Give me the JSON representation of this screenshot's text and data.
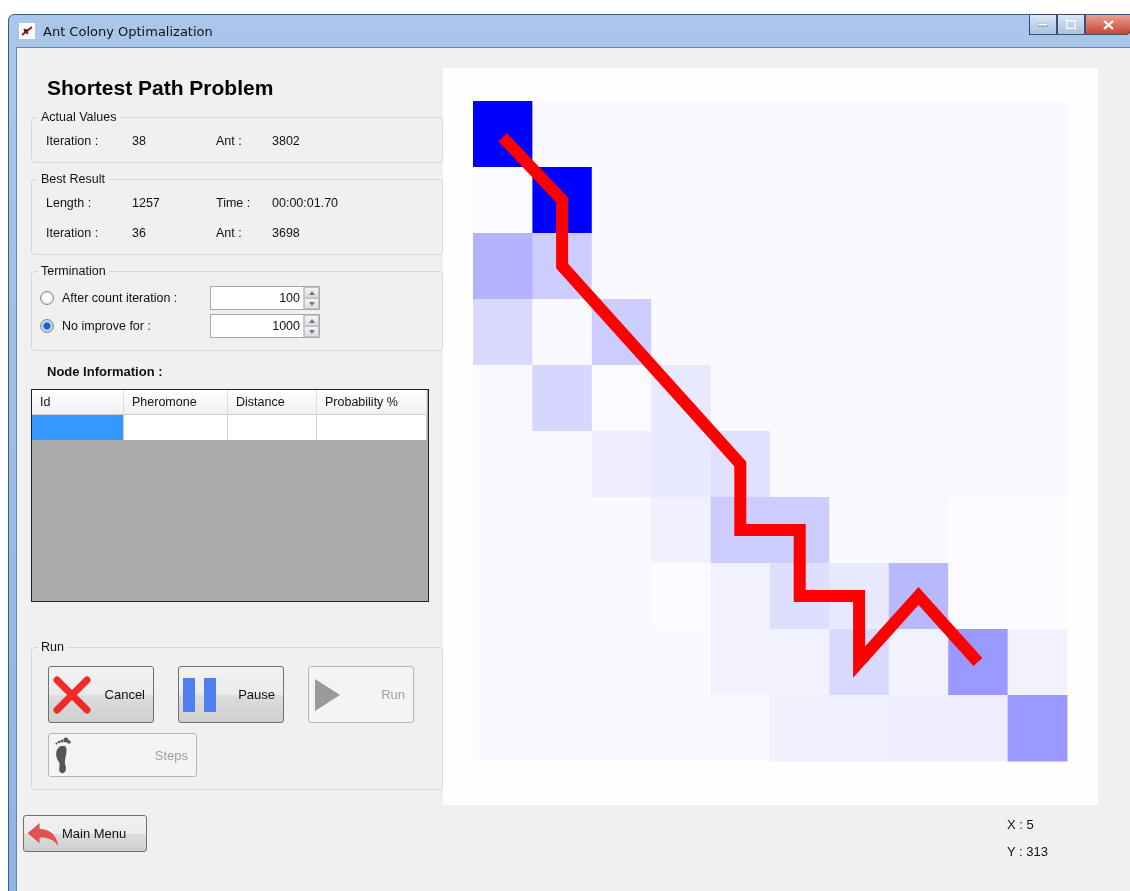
{
  "window": {
    "title": "Ant Colony Optimalization"
  },
  "heading": "Shortest Path Problem",
  "actual_values": {
    "title": "Actual Values",
    "fields": [
      {
        "label": "Iteration :",
        "value": "38"
      },
      {
        "label": "Ant :",
        "value": "3802"
      }
    ]
  },
  "best_result": {
    "title": "Best Result",
    "fields": [
      {
        "label": "Length :",
        "value": "1257"
      },
      {
        "label": "Time :",
        "value": "00:00:01.70"
      },
      {
        "label": "Iteration :",
        "value": "36"
      },
      {
        "label": "Ant :",
        "value": "3698"
      }
    ]
  },
  "termination": {
    "title": "Termination",
    "options": [
      {
        "label": "After count iteration :",
        "selected": false,
        "value": "100"
      },
      {
        "label": "No improve for :",
        "selected": true,
        "value": "1000"
      }
    ]
  },
  "node_information": {
    "title": "Node Information :",
    "columns": [
      "Id",
      "Pheromone",
      "Distance",
      "Probability %"
    ],
    "rows": [
      {
        "cells": [
          {
            "selected": true
          },
          {
            "selected": false
          },
          {
            "selected": false
          },
          {
            "selected": false
          }
        ]
      }
    ]
  },
  "run": {
    "title": "Run",
    "buttons": [
      {
        "kind": "cancel",
        "label": "Cancel",
        "disabled": false
      },
      {
        "kind": "pause",
        "label": "Pause",
        "disabled": false
      },
      {
        "kind": "run",
        "label": "Run",
        "disabled": true
      },
      {
        "kind": "steps",
        "label": "Steps",
        "disabled": true
      }
    ]
  },
  "main_menu": {
    "label": "Main Menu"
  },
  "coordinates": [
    "X : 5",
    "Y : 313"
  ]
}
